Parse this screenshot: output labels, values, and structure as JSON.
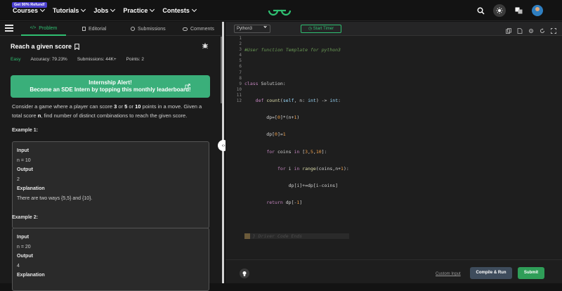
{
  "topnav": {
    "promo": "Get 90% Refund!",
    "menu": [
      "Courses",
      "Tutorials",
      "Jobs",
      "Practice",
      "Contests"
    ]
  },
  "tabs": [
    "Problem",
    "Editorial",
    "Submissions",
    "Comments"
  ],
  "problem": {
    "title": "Reach a given score",
    "difficulty": "Easy",
    "accuracy": "Accuracy: 79.23%",
    "submissions": "Submissions: 44K+",
    "points": "Points: 2",
    "alert_line1": "Internship Alert!",
    "alert_line2": "Become an SDE Intern by topping this monthly leaderboard!",
    "desc_a": "Consider a game where a player can score ",
    "desc_b": "3",
    "desc_c": " or ",
    "desc_d": "5",
    "desc_e": " or ",
    "desc_f": "10",
    "desc_g": " points in a move. Given a total score ",
    "desc_h": "n",
    "desc_i": ", find number of distinct combinations to reach the given score."
  },
  "examples": [
    {
      "heading": "Example 1:",
      "input_label": "Input",
      "input": "n = 10",
      "output_label": "Output",
      "output": "2",
      "expl_label": "Explanation",
      "expl": "There are two ways {5,5} and {10}."
    },
    {
      "heading": "Example 2:",
      "input_label": "Input",
      "input": "n = 20",
      "output_label": "Output",
      "output": "4",
      "expl_label": "Explanation"
    }
  ],
  "editor": {
    "language": "Python3",
    "timer": "Start Timer",
    "line_numbers": [
      "1",
      "2",
      "3",
      "4",
      "5",
      "6",
      "7",
      "8",
      "9",
      "10",
      "11",
      "12"
    ],
    "custom_input": "Custom Input",
    "compile_run": "Compile & Run",
    "submit": "Submit"
  },
  "colors": {
    "accent": "#2fbf71",
    "alert": "#3aaf7a"
  }
}
